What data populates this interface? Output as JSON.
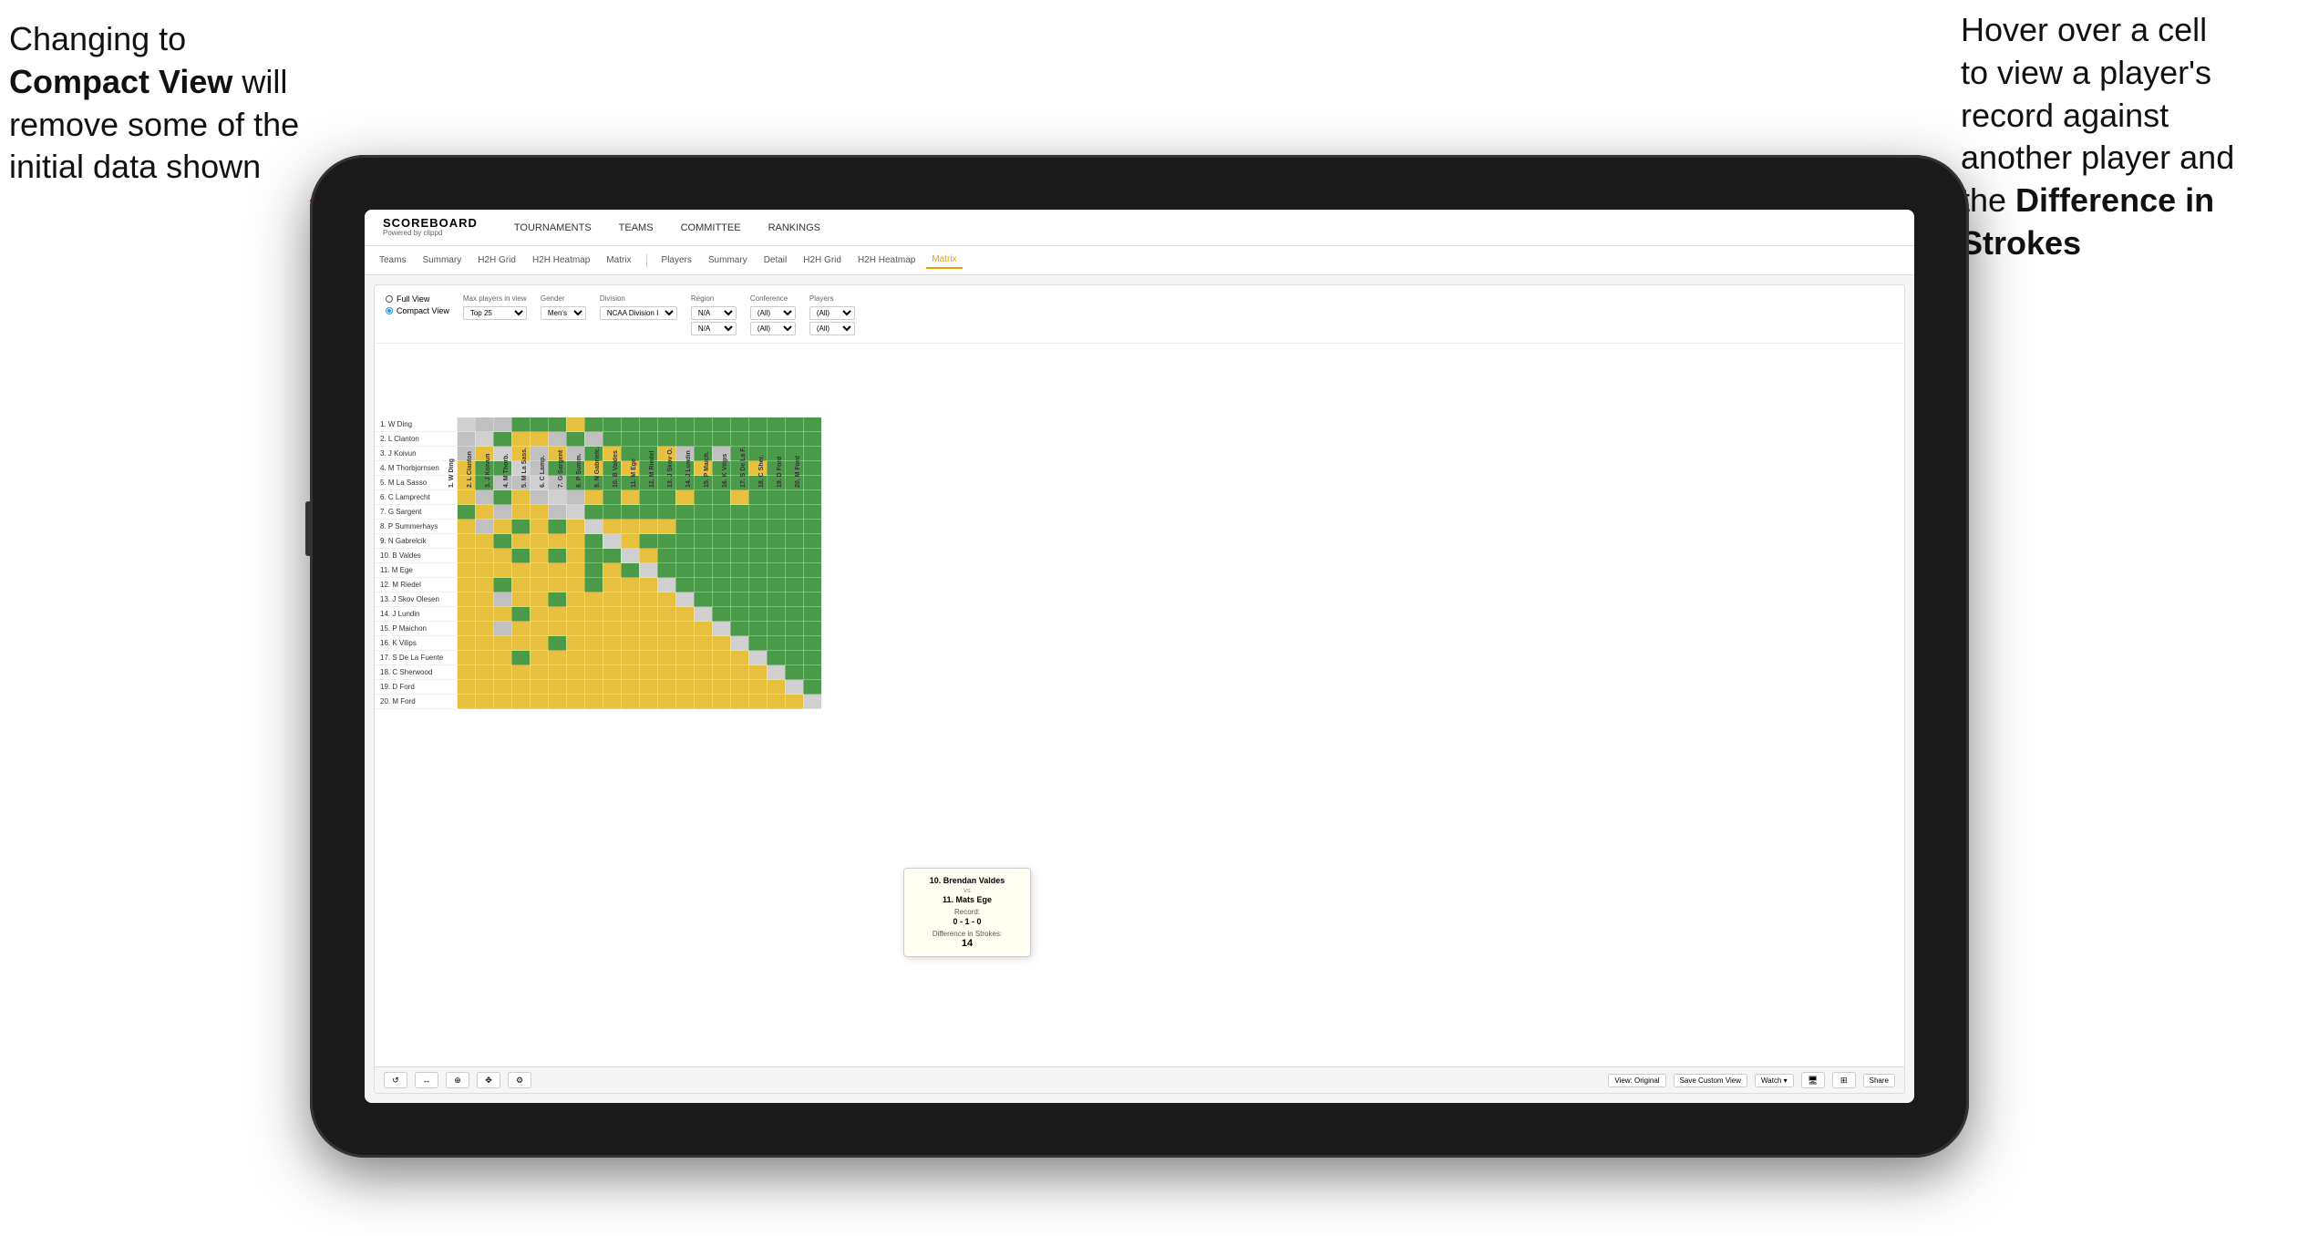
{
  "annotations": {
    "left_line1": "Changing to",
    "left_bold": "Compact View",
    "left_line2": " will",
    "left_line3": "remove some of the",
    "left_line4": "initial data shown",
    "right_line1": "Hover over a cell",
    "right_line2": "to view a player's",
    "right_line3": "record against",
    "right_line4": "another player and",
    "right_line5": "the ",
    "right_bold": "Difference in Strokes"
  },
  "app": {
    "logo_main": "SCOREBOARD",
    "logo_sub": "Powered by clippd",
    "nav": [
      "TOURNAMENTS",
      "TEAMS",
      "COMMITTEE",
      "RANKINGS"
    ]
  },
  "sub_nav": {
    "group1": [
      "Teams",
      "Summary",
      "H2H Grid",
      "H2H Heatmap",
      "Matrix"
    ],
    "group2_active": "Matrix",
    "group2": [
      "Players",
      "Summary",
      "Detail",
      "H2H Grid",
      "H2H Heatmap",
      "Matrix"
    ]
  },
  "filters": {
    "view_full": "Full View",
    "view_compact": "Compact View",
    "max_players_label": "Max players in view",
    "max_players_value": "Top 25",
    "gender_label": "Gender",
    "gender_value": "Men's",
    "division_label": "Division",
    "division_value": "NCAA Division I",
    "region_label": "Region",
    "region_value": "N/A",
    "region_value2": "N/A",
    "conference_label": "Conference",
    "conference_value": "(All)",
    "conference_value2": "(All)",
    "players_label": "Players",
    "players_value": "(All)",
    "players_value2": "(All)"
  },
  "players": [
    "1. W Ding",
    "2. L Clanton",
    "3. J Koivun",
    "4. M Thorbjornsen",
    "5. M La Sasso",
    "6. C Lamprecht",
    "7. G Sargent",
    "8. P Summerhays",
    "9. N Gabrelcik",
    "10. B Valdes",
    "11. M Ege",
    "12. M Riedel",
    "13. J Skov Olesen",
    "14. J Lundin",
    "15. P Maichon",
    "16. K Vilips",
    "17. S De La Fuente",
    "18. C Sherwood",
    "19. D Ford",
    "20. M Ford"
  ],
  "col_headers": [
    "1. W Ding",
    "2. L Clanton",
    "3. J Koivun",
    "4. M Thorb...",
    "5. M La Sass...",
    "6. C Lamp...",
    "7. G Sargent",
    "8. P Summ...",
    "9. N Gabrielc...",
    "10. B Valdes",
    "11. M Ege",
    "12. M Riedel",
    "13. J Skov O...",
    "14. J Lundin",
    "15. P Maich...",
    "16. K Vilips",
    "17. S De La...",
    "18. C Sher...",
    "19. D Ford",
    "20. M Fore..."
  ],
  "tooltip": {
    "player1": "10. Brendan Valdes",
    "vs": "vs",
    "player2": "11. Mats Ege",
    "record_label": "Record:",
    "record": "0 - 1 - 0",
    "diff_label": "Difference in Strokes:",
    "diff_value": "14"
  },
  "toolbar": {
    "undo": "↺",
    "redo": "↻",
    "zoom_out": "−",
    "zoom_in": "+",
    "refresh": "⟳",
    "settings": "⚙",
    "view_original": "View: Original",
    "save_custom": "Save Custom View",
    "watch": "Watch ▾",
    "share": "Share",
    "monitor": "🖥",
    "grid": "⊞"
  },
  "colors": {
    "green": "#4a9a4a",
    "yellow": "#e8c040",
    "gray": "#b8b8b8",
    "white": "#f5f5f5",
    "accent_orange": "#e8a000",
    "arrow_pink": "#e91e8c"
  }
}
